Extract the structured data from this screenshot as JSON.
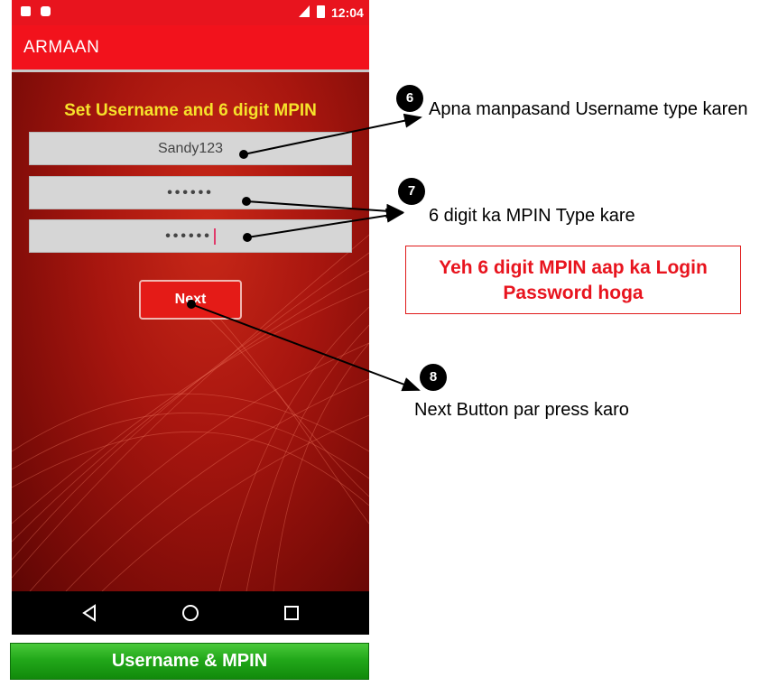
{
  "status_bar": {
    "time": "12:04"
  },
  "app_bar": {
    "title": "ARMAAN"
  },
  "form": {
    "title": "Set Username and 6 digit MPIN",
    "username_value": "Sandy123",
    "mpin_value": "••••••",
    "confirm_mpin_value": "••••••",
    "next_label": "Next"
  },
  "nav_bar": {
    "back_icon": "back-triangle",
    "home_icon": "home-circle",
    "recents_icon": "recents-square"
  },
  "annotations": {
    "step_6": {
      "number": "6",
      "text": "Apna manpasand Username type karen"
    },
    "step_7": {
      "number": "7",
      "text": "6 digit ka MPIN Type kare"
    },
    "step_8": {
      "number": "8",
      "text": "Next Button par press karo"
    },
    "highlight_note": "Yeh 6 digit MPIN aap ka Login Password hoga"
  },
  "banner": {
    "label": "Username & MPIN"
  },
  "colors": {
    "app_red": "#f2121c",
    "title_yellow": "#f6e22b",
    "banner_green": "#22a81a",
    "note_red": "#e8141e"
  }
}
